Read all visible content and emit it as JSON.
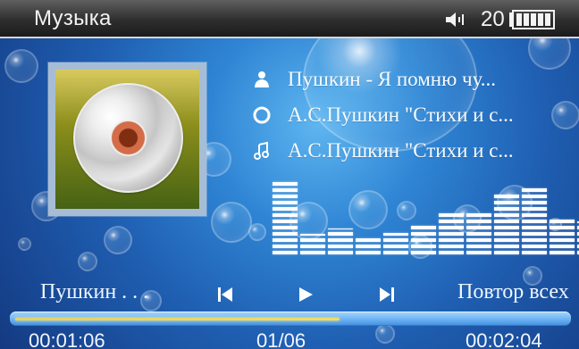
{
  "status_bar": {
    "title": "Музыка",
    "volume_icon": "speaker-icon",
    "volume_value": "20",
    "battery_icon": "battery-icon"
  },
  "now_playing": {
    "artist_line": "Пушкин - Я помню чу...",
    "album_line": "А.С.Пушкин \"Стихи и с...",
    "track_line": "А.С.Пушкин \"Стихи и с...",
    "artist_short": "Пушкин . . .",
    "repeat_mode": "Повтор всех",
    "artist_icon": "person-icon",
    "album_icon": "disc-icon",
    "track_icon": "music-note-icon"
  },
  "controls": {
    "prev_icon": "previous-icon",
    "play_icon": "play-icon",
    "next_icon": "next-icon"
  },
  "progress": {
    "elapsed": "00:01:06",
    "total": "00:02:04",
    "fraction": 0.59,
    "track_index": "01/06"
  },
  "equalizer": {
    "levels": [
      0.92,
      0.26,
      0.33,
      0.2,
      0.27,
      0.39,
      0.53,
      0.53,
      0.78,
      0.88,
      0.46,
      0.42
    ]
  },
  "colors": {
    "accent_progress": "#f3dc61",
    "status_bar": "#2e2e2e"
  }
}
